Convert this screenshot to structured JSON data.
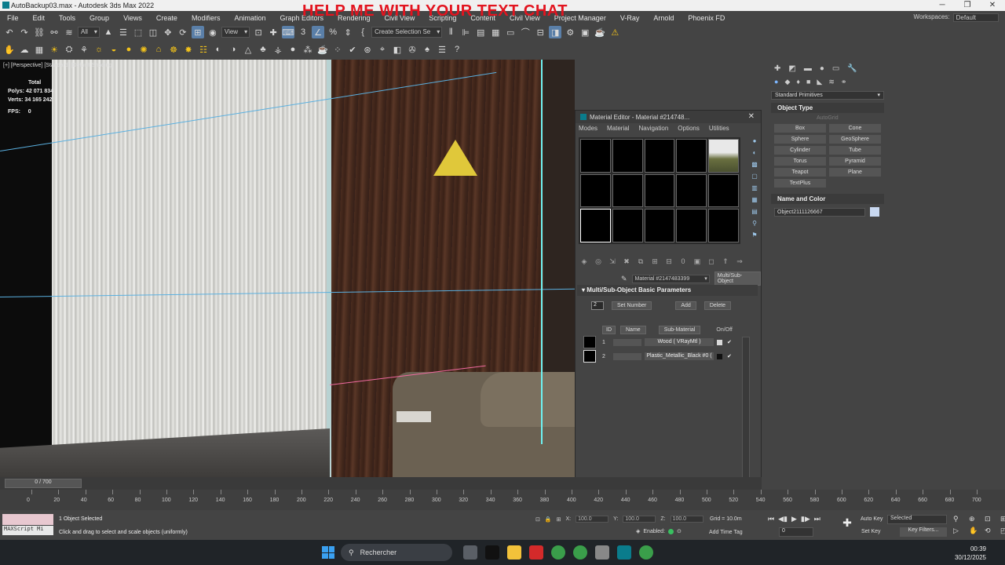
{
  "title_bar": {
    "title": "AutoBackup03.max - Autodesk 3ds Max 2022",
    "overlay_banner": "HELP ME WITH YOUR TEXT CHAT",
    "minimize": "─",
    "restore": "❐",
    "close": "✕"
  },
  "menubar": {
    "items": [
      "File",
      "Edit",
      "Tools",
      "Group",
      "Views",
      "Create",
      "Modifiers",
      "Animation",
      "Graph Editors",
      "Rendering",
      "Civil View",
      "Scripting",
      "Content",
      "Civil View",
      "Project Manager",
      "V-Ray",
      "Arnold",
      "Phoenix FD"
    ],
    "workspaces_label": "Workspaces:",
    "workspace_value": "Default"
  },
  "toolbar": {
    "selection_filter": "All",
    "reference_coord": "View",
    "named_selection": "Create Selection Se"
  },
  "viewport": {
    "label": "[+] [Perspective] [Standard] [Default Shading]",
    "stats_header": "Total",
    "polys_label": "Polys:",
    "polys_value": "42 071 834",
    "verts_label": "Verts:",
    "verts_value": "34 165 242",
    "fps_label": "FPS:",
    "fps_value": "0"
  },
  "material_editor": {
    "title": "Material Editor - Material #214748...",
    "menu": [
      "Modes",
      "Material",
      "Navigation",
      "Options",
      "Utilities"
    ],
    "material_name": "Material #2147483399",
    "material_type": "Multi/Sub-Object",
    "rollout_title": "Multi/Sub-Object Basic Parameters",
    "num_sub": "2",
    "set_number": "Set Number",
    "add": "Add",
    "delete": "Delete",
    "col_id": "ID",
    "col_name": "Name",
    "col_sub": "Sub-Material",
    "col_onoff": "On/Off",
    "rows": [
      {
        "id": "1",
        "sub": "Wood ( VRayMtl )",
        "color": "#d8d8d8"
      },
      {
        "id": "2",
        "sub": "Plastic_Metallic_Black #0 (",
        "color": "#111111"
      }
    ]
  },
  "command_panel": {
    "dropdown": "Standard Primitives",
    "object_type": "Object Type",
    "autogrid": "AutoGrid",
    "primitives": [
      "Box",
      "Cone",
      "Sphere",
      "GeoSphere",
      "Cylinder",
      "Tube",
      "Torus",
      "Pyramid",
      "Teapot",
      "Plane",
      "TextPlus"
    ],
    "name_color": "Name and Color",
    "object_name": "Object2111126667",
    "object_color": "#c8d8f0"
  },
  "time_slider": {
    "position": "0 / 700",
    "ticks": [
      "0",
      "20",
      "40",
      "60",
      "80",
      "100",
      "120",
      "140",
      "160",
      "180",
      "200",
      "220",
      "240",
      "260",
      "280",
      "300",
      "320",
      "340",
      "360",
      "380",
      "400",
      "420",
      "440",
      "460",
      "480",
      "500",
      "520",
      "540",
      "560",
      "580",
      "600",
      "620",
      "640",
      "660",
      "680",
      "700"
    ]
  },
  "status": {
    "script_label": "MAXScript Mi",
    "selected": "1 Object Selected",
    "prompt": "Click and drag to select and scale objects (uniformly)",
    "x_label": "X:",
    "x_value": "100.0",
    "y_label": "Y:",
    "y_value": "100.0",
    "z_label": "Z:",
    "z_value": "100.0",
    "grid": "Grid = 10.0m",
    "enabled": "Enabled:",
    "add_time_tag": "Add Time Tag",
    "frame": "0",
    "auto_key": "Auto Key",
    "set_key": "Set Key",
    "selected_set": "Selected",
    "key_filters": "Key Filters..."
  },
  "taskbar": {
    "search_placeholder": "Rechercher",
    "time": "00:39",
    "date": "30/12/2025"
  }
}
